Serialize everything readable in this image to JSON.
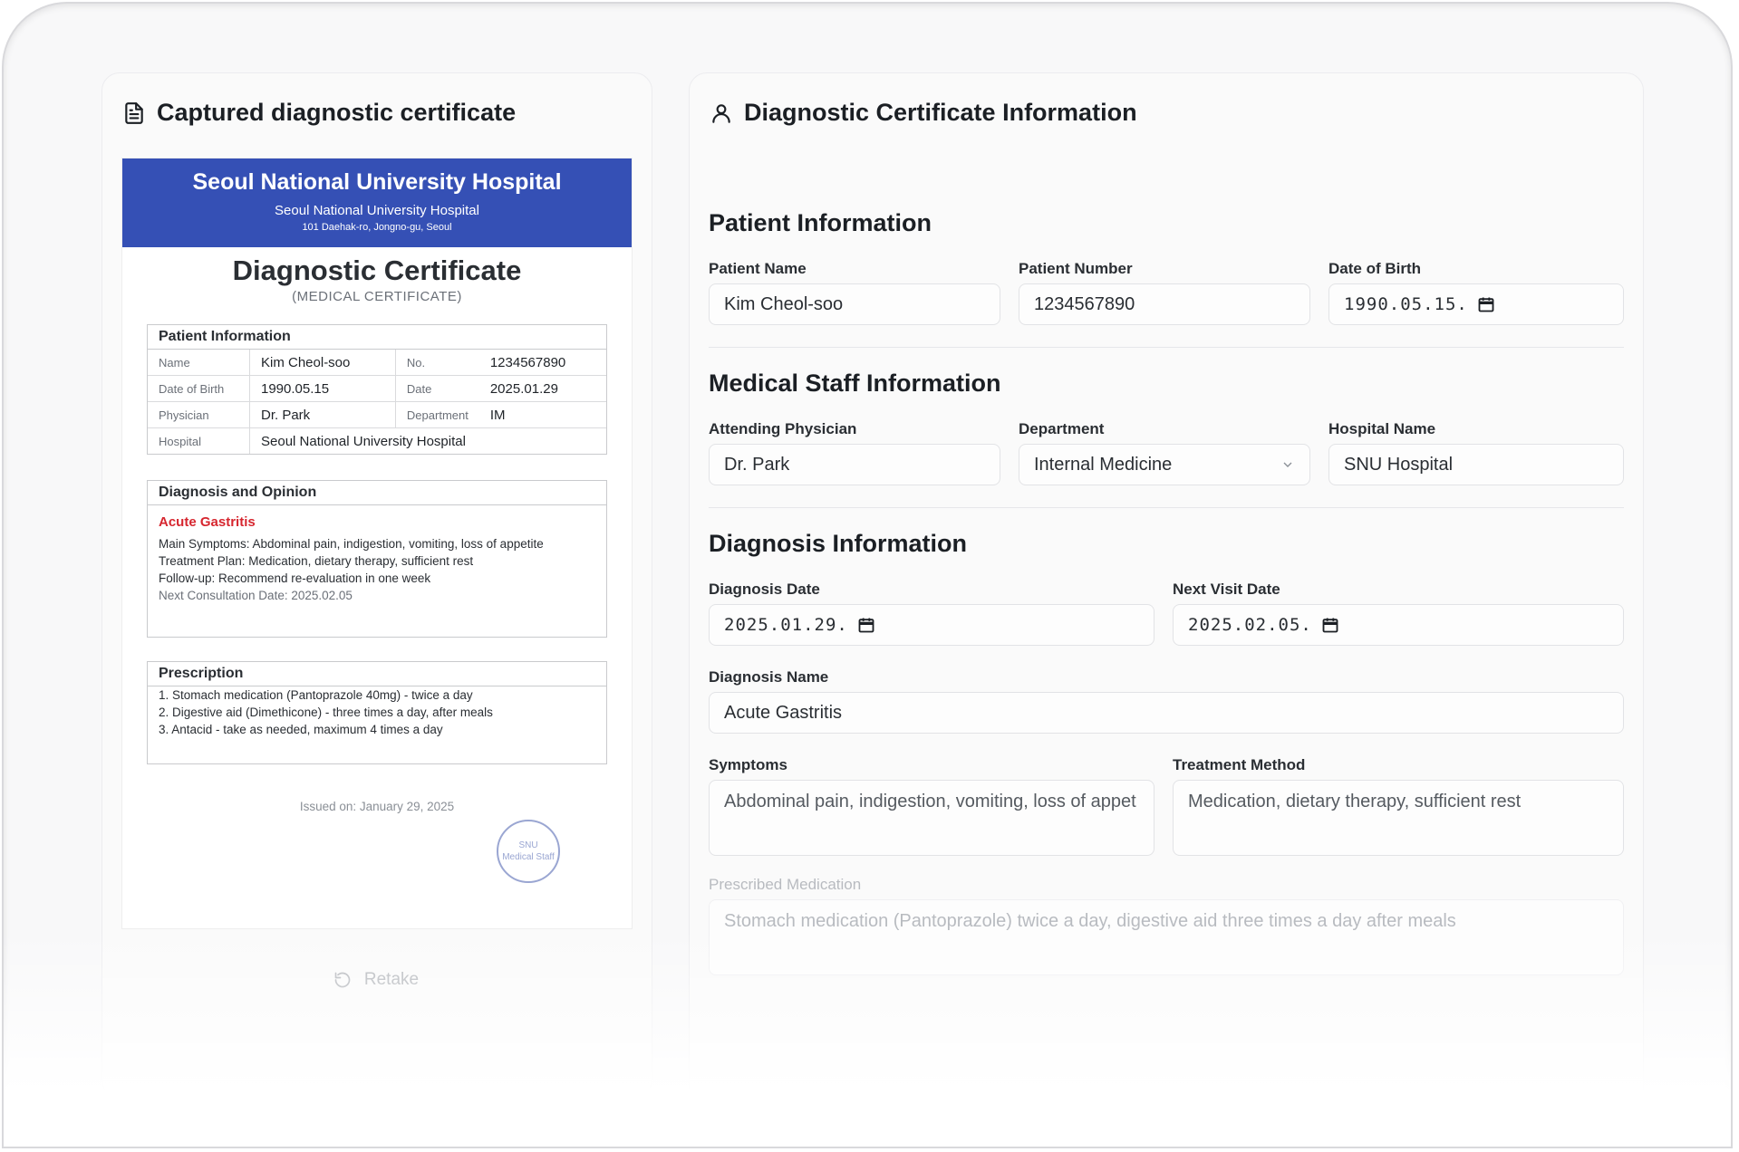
{
  "left_panel": {
    "title": "Captured diagnostic certificate",
    "certificate": {
      "hospital_name": "Seoul National University Hospital",
      "hospital_sub": "Seoul National University Hospital",
      "address": "101 Daehak-ro, Jongno-gu, Seoul",
      "title": "Diagnostic Certificate",
      "title_sub": "(MEDICAL CERTIFICATE)",
      "patient_info": {
        "heading": "Patient Information",
        "name_label": "Name",
        "name": "Kim Cheol-soo",
        "no_label": "No.",
        "no": "1234567890",
        "dob_label": "Date of Birth",
        "dob": "1990.05.15",
        "date_label": "Date",
        "date": "2025.01.29",
        "physician_label": "Physician",
        "physician": "Dr. Park",
        "department_label": "Department",
        "department": "IM",
        "hospital_label": "Hospital",
        "hospital": "Seoul National University Hospital"
      },
      "diagnosis": {
        "heading": "Diagnosis and Opinion",
        "name": "Acute Gastritis",
        "symptoms": "Main Symptoms: Abdominal pain, indigestion, vomiting, loss of appetite",
        "plan": "Treatment Plan: Medication, dietary therapy, sufficient rest",
        "followup": "Follow-up: Recommend re-evaluation in one week",
        "next": "Next Consultation Date: 2025.02.05"
      },
      "prescription": {
        "heading": "Prescription",
        "items": [
          "1. Stomach medication (Pantoprazole 40mg) - twice a day",
          "2. Digestive aid (Dimethicone) - three times a day, after meals",
          "3. Antacid - take as needed, maximum 4 times a day"
        ]
      },
      "issued": "Issued on: January 29, 2025",
      "stamp_line1": "SNU",
      "stamp_line2": "Medical Staff"
    },
    "retake_label": "Retake"
  },
  "right_panel": {
    "title": "Diagnostic Certificate Information",
    "patient_section": {
      "title": "Patient Information",
      "name_label": "Patient Name",
      "name_value": "Kim Cheol-soo",
      "number_label": "Patient Number",
      "number_value": "1234567890",
      "dob_label": "Date of Birth",
      "dob_value": "1990.05.15."
    },
    "staff_section": {
      "title": "Medical Staff Information",
      "physician_label": "Attending Physician",
      "physician_value": "Dr. Park",
      "department_label": "Department",
      "department_value": "Internal Medicine",
      "hospital_label": "Hospital Name",
      "hospital_value": "SNU Hospital"
    },
    "diagnosis_section": {
      "title": "Diagnosis Information",
      "date_label": "Diagnosis Date",
      "date_value": "2025.01.29.",
      "next_label": "Next Visit Date",
      "next_value": "2025.02.05.",
      "name_label": "Diagnosis Name",
      "name_value": "Acute Gastritis",
      "symptoms_label": "Symptoms",
      "symptoms_value": "Abdominal pain, indigestion, vomiting, loss of appet",
      "treatment_label": "Treatment Method",
      "treatment_value": "Medication, dietary therapy, sufficient rest",
      "medication_label": "Prescribed Medication",
      "medication_value": "Stomach medication (Pantoprazole) twice a day, digestive aid three times a day after meals"
    }
  }
}
